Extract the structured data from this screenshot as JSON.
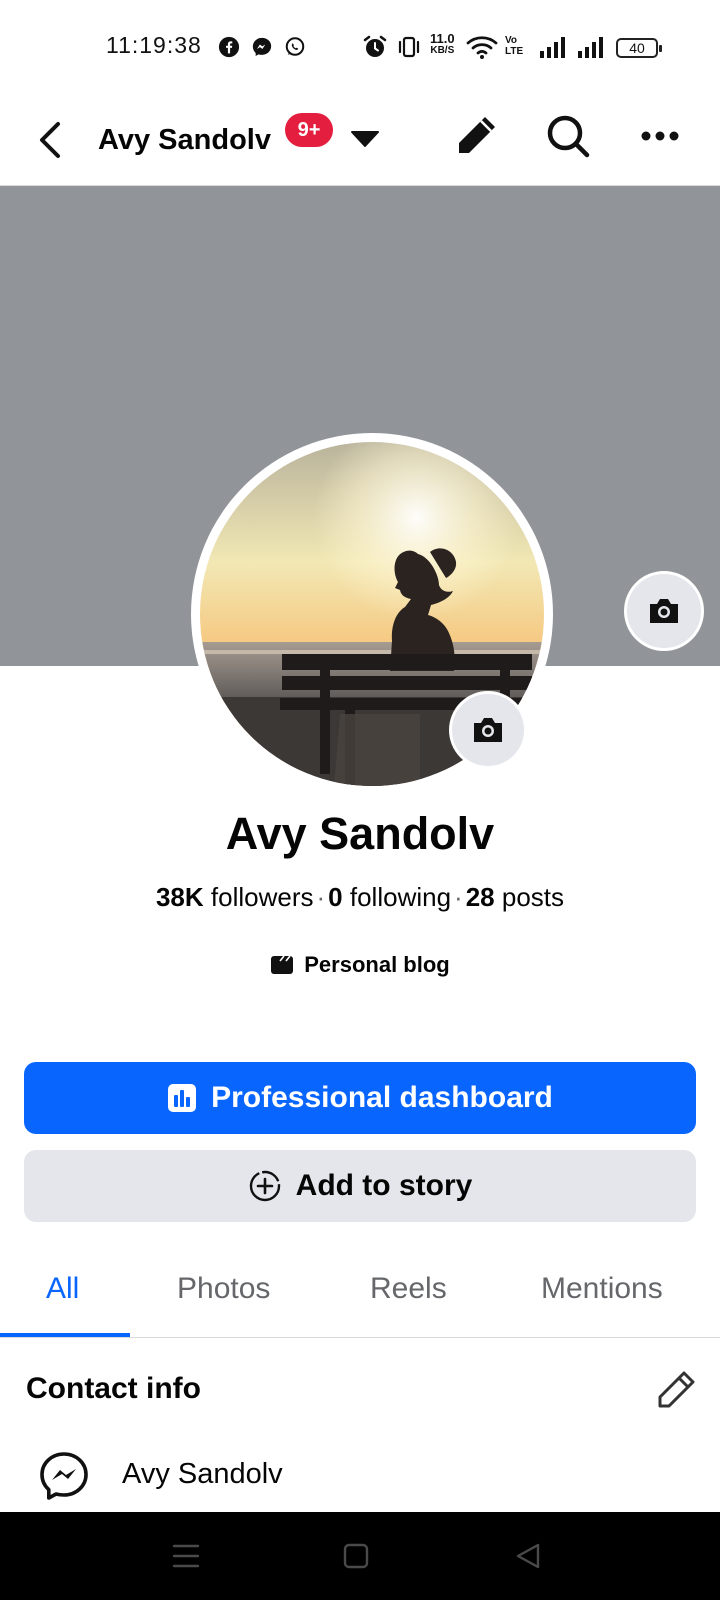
{
  "status_bar": {
    "time": "11:19:38",
    "net_speed_value": "11.0",
    "net_speed_unit": "KB/S",
    "volte_top": "Vo",
    "volte_bottom": "LTE",
    "battery": "40",
    "app_icons": [
      "facebook-icon",
      "messenger-icon",
      "whatsapp-icon"
    ],
    "right_icons": [
      "alarm-icon",
      "vibrate-icon",
      "wifi-icon",
      "signal-icon",
      "signal-icon"
    ]
  },
  "header": {
    "title": "Avy Sandolv",
    "badge": "9+",
    "icons": [
      "back-arrow-icon",
      "caret-down-icon",
      "pencil-icon",
      "search-icon",
      "more-icon"
    ]
  },
  "profile": {
    "name": "Avy Sandolv",
    "followers_count": "38K",
    "followers_label": "followers",
    "following_count": "0",
    "following_label": "following",
    "posts_count": "28",
    "posts_label": "posts",
    "category": "Personal blog"
  },
  "actions": {
    "primary": "Professional dashboard",
    "secondary": "Add to story"
  },
  "tabs": [
    {
      "label": "All",
      "active": true
    },
    {
      "label": "Photos",
      "active": false
    },
    {
      "label": "Reels",
      "active": false
    },
    {
      "label": "Mentions",
      "active": false
    }
  ],
  "contact": {
    "title": "Contact info",
    "messenger_name": "Avy Sandolv"
  },
  "colors": {
    "brand_blue": "#0866ff",
    "badge_red": "#e41e3f",
    "cover_gray": "#919498",
    "secondary_button": "#e4e6eb"
  }
}
